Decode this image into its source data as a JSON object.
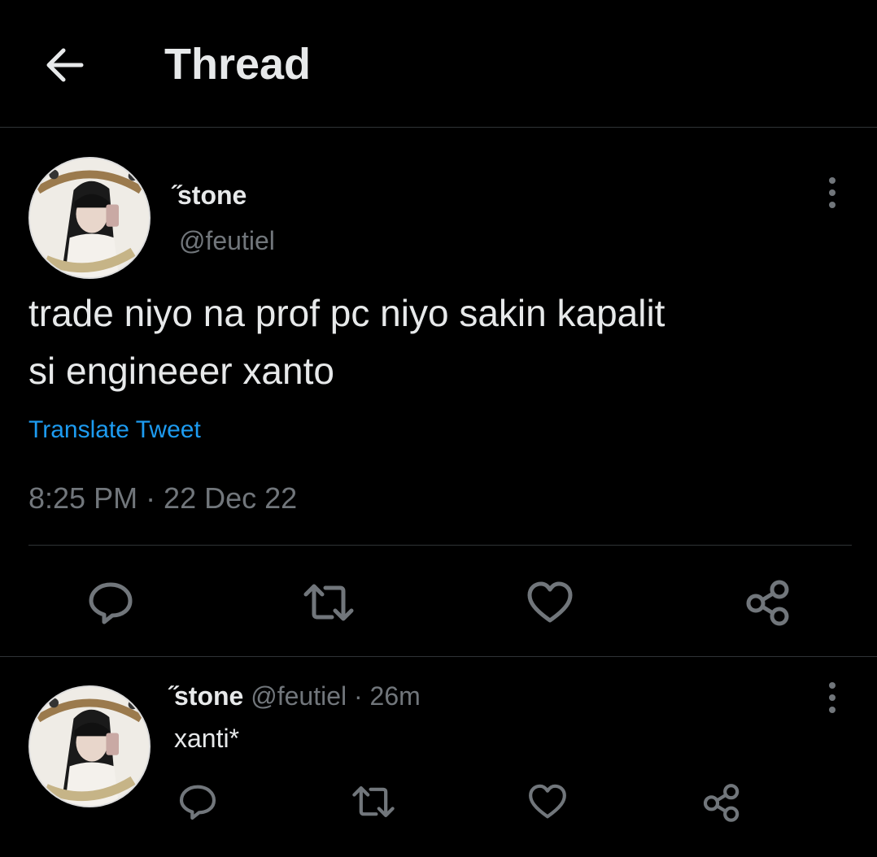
{
  "header": {
    "back_icon": "arrow-left-icon",
    "title": "Thread"
  },
  "main_tweet": {
    "avatar_icon": "profile-avatar",
    "display_name": "̋stone",
    "handle": "@feutiel",
    "text_line1": "trade niyo na prof pc niyo sakin kapalit",
    "text_line2": "si engineeer xanto",
    "translate_label": "Translate Tweet",
    "timestamp": "8:25 PM · 22 Dec 22",
    "more_icon": "more-vertical-icon",
    "actions": {
      "reply_icon": "reply-icon",
      "retweet_icon": "retweet-icon",
      "like_icon": "heart-icon",
      "share_icon": "share-icon"
    }
  },
  "reply_tweet": {
    "avatar_icon": "profile-avatar",
    "display_name": "̋stone",
    "handle": "@feutiel",
    "separator": "·",
    "time": "26m",
    "text": "xanti*",
    "more_icon": "more-vertical-icon",
    "actions": {
      "reply_icon": "reply-icon",
      "retweet_icon": "retweet-icon",
      "like_icon": "heart-icon",
      "share_icon": "share-icon"
    }
  },
  "colors": {
    "background": "#000000",
    "text_primary": "#e7e9ea",
    "text_secondary": "#71767b",
    "link": "#1d9bf0",
    "divider": "#2f3336"
  }
}
